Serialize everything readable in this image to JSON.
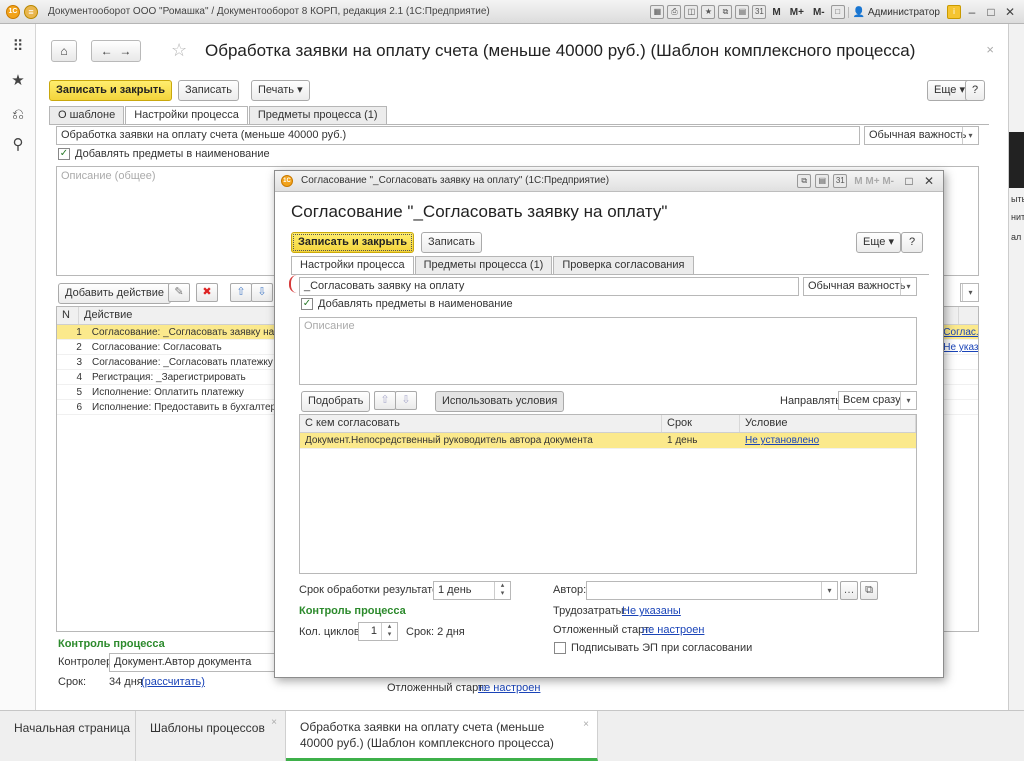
{
  "app": {
    "window_title": "Документооборот ООО \"Ромашка\" / Документооборот 8 КОРП, редакция 2.1  (1С:Предприятие)",
    "user": "Администратор",
    "tb_m": "M",
    "tb_mplus": "M+",
    "tb_mminus": "M-"
  },
  "main": {
    "title": "Обработка заявки на оплату счета (меньше 40000 руб.) (Шаблон комплексного процесса)",
    "btn_save_close": "Записать и закрыть",
    "btn_save": "Записать",
    "btn_print": "Печать",
    "btn_more": "Еще",
    "btn_help": "?",
    "tabs": [
      "О шаблоне",
      "Настройки процесса",
      "Предметы процесса (1)"
    ],
    "name_value": "Обработка заявки на оплату счета (меньше 40000 руб.)",
    "importance": "Обычная важность",
    "add_subjects_label": "Добавлять предметы в наименование",
    "description_placeholder": "Описание (общее)",
    "btn_add_action": "Добавить действие",
    "grid_headers": [
      "N",
      "Действие"
    ],
    "actions": [
      {
        "n": "1",
        "text": "Согласование: _Согласовать заявку на оплату"
      },
      {
        "n": "2",
        "text": "Согласование: Согласовать"
      },
      {
        "n": "3",
        "text": "Согласование: _Согласовать платежку"
      },
      {
        "n": "4",
        "text": "Регистрация: _Зарегистрировать"
      },
      {
        "n": "5",
        "text": "Исполнение: Оплатить платежку"
      },
      {
        "n": "6",
        "text": "Исполнение: Предоставить в бухгалтерию"
      }
    ],
    "right_col": [
      "Соглас...",
      "Не указано, есл..."
    ],
    "control_title": "Контроль процесса",
    "controller_label": "Контролер:",
    "controller_value": "Документ.Автор документа",
    "term_label": "Срок:",
    "term_value": "34 дня",
    "term_link": "(рассчитать)",
    "deferred_label": "Отложенный старт:",
    "deferred_link": "не настроен"
  },
  "dialog": {
    "window_title": "Согласование \"_Согласовать заявку на оплату\"  (1С:Предприятие)",
    "title": "Согласование \"_Согласовать заявку на оплату\"",
    "btn_save_close": "Записать и закрыть",
    "btn_save": "Записать",
    "btn_more": "Еще",
    "btn_help": "?",
    "tabs": [
      "Настройки процесса",
      "Предметы процесса (1)",
      "Проверка согласования"
    ],
    "name_value": "_Согласовать заявку на оплату",
    "importance": "Обычная важность",
    "add_subjects_label": "Добавлять предметы в наименование",
    "description_placeholder": "Описание",
    "btn_pick": "Подобрать",
    "btn_conditions": "Использовать условия",
    "direction_label": "Направлять:",
    "direction_value": "Всем сразу",
    "grid_headers": [
      "С кем согласовать",
      "Срок",
      "Условие"
    ],
    "rows": [
      {
        "who": "Документ.Непосредственный руководитель автора документа",
        "term": "1 день",
        "cond": "Не установлено"
      }
    ],
    "result_term_label": "Срок обработки результатов:",
    "result_term_value": "1 день",
    "author_label": "Автор:",
    "control_title": "Контроль процесса",
    "cycles_label": "Кол. циклов:",
    "cycles_value": "1",
    "term_text": "Срок: 2 дня",
    "labor_label": "Трудозатраты:",
    "labor_link": "Не указаны",
    "deferred_label": "Отложенный старт:",
    "deferred_link": "не настроен",
    "sign_label": "Подписывать ЭП при согласовании"
  },
  "taskbar": {
    "tabs": [
      "Начальная страница",
      "Шаблоны процессов",
      "Обработка заявки на оплату счета (меньше 40000 руб.) (Шаблон комплексного процесса)"
    ]
  },
  "right_strip": [
    "ыть",
    "нит",
    "ал"
  ]
}
